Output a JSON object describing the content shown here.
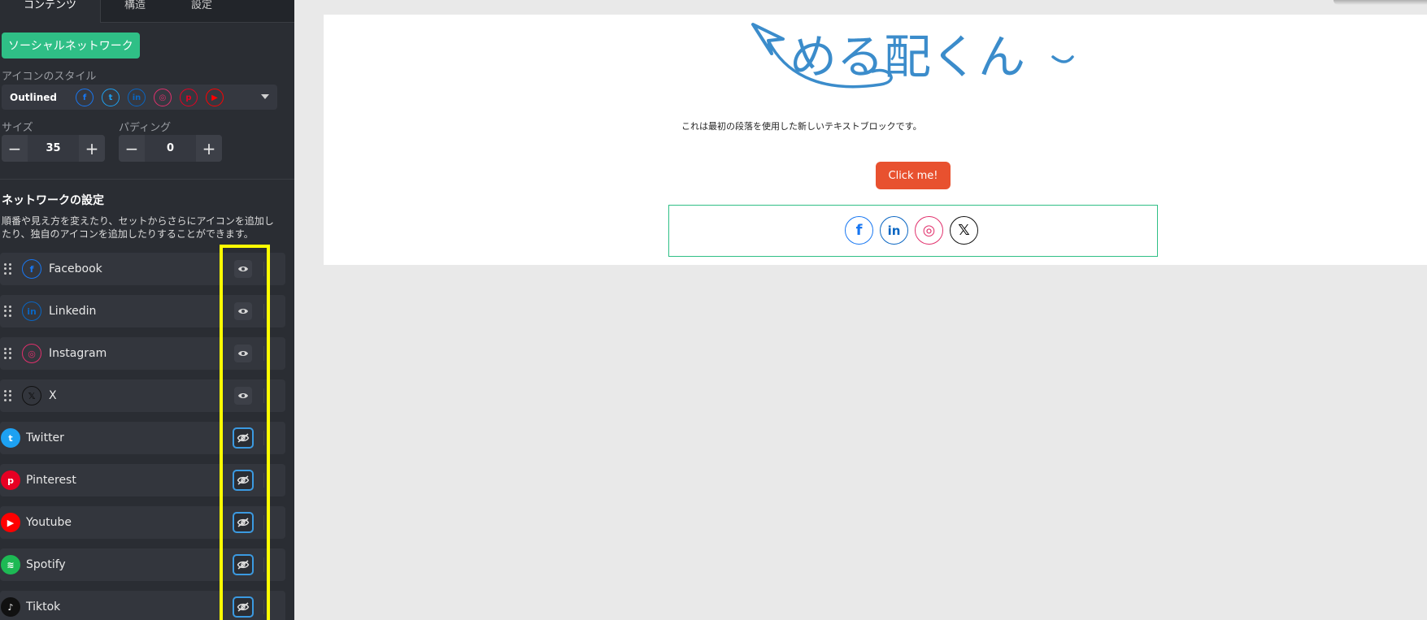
{
  "tabs": [
    {
      "label": "コンテンツ",
      "active": true
    },
    {
      "label": "構造",
      "active": false
    },
    {
      "label": "設定",
      "active": false
    }
  ],
  "social_button_label": "ソーシャルネットワーク",
  "icon_style": {
    "label": "アイコンのスタイル",
    "value": "Outlined",
    "preview_icons": [
      {
        "name": "facebook-icon",
        "glyph": "f",
        "color": "#1877f2"
      },
      {
        "name": "twitter-icon",
        "glyph": "t",
        "color": "#1da1f2"
      },
      {
        "name": "linkedin-icon",
        "glyph": "in",
        "color": "#0a66c2"
      },
      {
        "name": "instagram-icon",
        "glyph": "◎",
        "color": "#e1306c"
      },
      {
        "name": "pinterest-icon",
        "glyph": "p",
        "color": "#e60023"
      },
      {
        "name": "youtube-icon",
        "glyph": "▶",
        "color": "#ff0000"
      }
    ]
  },
  "size": {
    "label": "サイズ",
    "value": "35",
    "minus": "−",
    "plus": "+"
  },
  "padding": {
    "label": "パディング",
    "value": "0",
    "minus": "−",
    "plus": "+"
  },
  "network_settings": {
    "title": "ネットワークの設定",
    "description": "順番や見え方を変えたり、セットからさらにアイコンを追加したり、独自のアイコンを追加したりすることができます。",
    "items": [
      {
        "label": "Facebook",
        "glyph": "f",
        "color": "#1877f2",
        "visible": true,
        "draggable": true,
        "solid": false
      },
      {
        "label": "Linkedin",
        "glyph": "in",
        "color": "#0a66c2",
        "visible": true,
        "draggable": true,
        "solid": false
      },
      {
        "label": "Instagram",
        "glyph": "◎",
        "color": "#e1306c",
        "visible": true,
        "draggable": true,
        "solid": false
      },
      {
        "label": "X",
        "glyph": "𝕏",
        "color": "#111111",
        "visible": true,
        "draggable": true,
        "solid": false
      },
      {
        "label": "Twitter",
        "glyph": "t",
        "color": "#1da1f2",
        "visible": false,
        "draggable": false,
        "solid": true
      },
      {
        "label": "Pinterest",
        "glyph": "p",
        "color": "#e60023",
        "visible": false,
        "draggable": false,
        "solid": true
      },
      {
        "label": "Youtube",
        "glyph": "▶",
        "color": "#ff0000",
        "visible": false,
        "draggable": false,
        "solid": true
      },
      {
        "label": "Spotify",
        "glyph": "≋",
        "color": "#1db954",
        "visible": false,
        "draggable": false,
        "solid": true
      },
      {
        "label": "Tiktok",
        "glyph": "♪",
        "color": "#111111",
        "visible": false,
        "draggable": false,
        "solid": true
      }
    ]
  },
  "canvas": {
    "logo_text": "める配くん",
    "paragraph": "これは最初の段落を使用した新しいテキストブロックです。",
    "button_label": "Click me!",
    "social_icons": [
      {
        "name": "facebook-icon",
        "glyph": "f",
        "color": "#1877f2"
      },
      {
        "name": "linkedin-icon",
        "glyph": "in",
        "color": "#0a66c2"
      },
      {
        "name": "instagram-icon",
        "glyph": "◎",
        "color": "#e1306c"
      },
      {
        "name": "x-icon",
        "glyph": "𝕏",
        "color": "#111111"
      }
    ]
  },
  "colors": {
    "accent_green": "#2fbf86",
    "cta_orange": "#e8512f",
    "logo_blue": "#3b8ccb",
    "highlight_yellow": "#ffff00",
    "hidden_blue": "#3b9ae1"
  }
}
